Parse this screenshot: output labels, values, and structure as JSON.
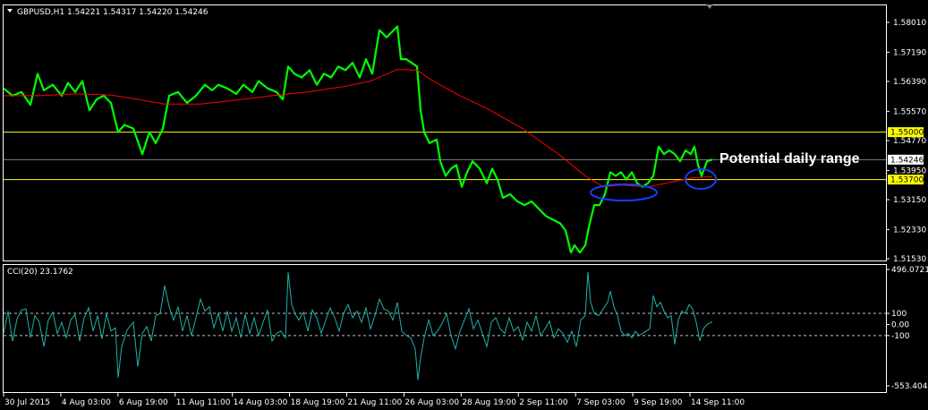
{
  "main_title": "GBPUSD,H1  1.54221 1.54317 1.54220 1.54246",
  "cci_title": "CCI(20) 23.1762",
  "annotation": "Potential daily range",
  "colors": {
    "background": "#000000",
    "price": "#00ff00",
    "ma": "#ff0000",
    "cci": "#20b2aa",
    "levels": "#ffff00",
    "current_line": "#808080",
    "ellipse": "#0000ff",
    "frame": "#ffffff"
  },
  "chart_data": [
    {
      "type": "line",
      "panel": "price",
      "symbol": "GBPUSD",
      "timeframe": "H1",
      "ohlc": {
        "open": 1.54221,
        "high": 1.54317,
        "low": 1.5422,
        "close": 1.54246
      },
      "ylim": [
        1.5153,
        1.5833
      ],
      "y_ticks": [
        "1.58010",
        "1.57190",
        "1.56390",
        "1.55570",
        "1.54770",
        "1.53950",
        "1.53150",
        "1.52330",
        "1.51530"
      ],
      "x_ticks": [
        "30 Jul 2015",
        "4 Aug 03:00",
        "6 Aug 19:00",
        "11 Aug 11:00",
        "14 Aug 03:00",
        "18 Aug 19:00",
        "21 Aug 11:00",
        "26 Aug 03:00",
        "28 Aug 19:00",
        "2 Sep 11:00",
        "7 Sep 03:00",
        "9 Sep 19:00",
        "14 Sep 11:00"
      ],
      "levels": [
        {
          "value": 1.55,
          "label": "1.55000",
          "color": "#ffff00"
        },
        {
          "value": 1.537,
          "label": "1.53700",
          "color": "#ffff00"
        }
      ],
      "current_price": {
        "value": 1.54246,
        "label": "1.54246"
      },
      "series": [
        {
          "color": "#00ff00",
          "values": [
            [
              0,
              1.562
            ],
            [
              10,
              1.56
            ],
            [
              20,
              1.561
            ],
            [
              30,
              1.5575
            ],
            [
              38,
              1.566
            ],
            [
              45,
              1.5615
            ],
            [
              55,
              1.563
            ],
            [
              65,
              1.56
            ],
            [
              72,
              1.5635
            ],
            [
              80,
              1.561
            ],
            [
              88,
              1.564
            ],
            [
              96,
              1.556
            ],
            [
              104,
              1.559
            ],
            [
              112,
              1.56
            ],
            [
              120,
              1.558
            ],
            [
              128,
              1.55
            ],
            [
              135,
              1.552
            ],
            [
              145,
              1.551
            ],
            [
              155,
              1.544
            ],
            [
              163,
              1.55
            ],
            [
              170,
              1.547
            ],
            [
              178,
              1.551
            ],
            [
              185,
              1.56
            ],
            [
              195,
              1.561
            ],
            [
              205,
              1.558
            ],
            [
              215,
              1.56
            ],
            [
              225,
              1.563
            ],
            [
              233,
              1.5615
            ],
            [
              240,
              1.563
            ],
            [
              250,
              1.562
            ],
            [
              260,
              1.5605
            ],
            [
              268,
              1.563
            ],
            [
              278,
              1.561
            ],
            [
              285,
              1.564
            ],
            [
              295,
              1.562
            ],
            [
              305,
              1.561
            ],
            [
              312,
              1.559
            ],
            [
              318,
              1.568
            ],
            [
              325,
              1.566
            ],
            [
              333,
              1.565
            ],
            [
              342,
              1.567
            ],
            [
              350,
              1.563
            ],
            [
              358,
              1.566
            ],
            [
              366,
              1.565
            ],
            [
              374,
              1.568
            ],
            [
              382,
              1.567
            ],
            [
              390,
              1.569
            ],
            [
              398,
              1.565
            ],
            [
              405,
              1.57
            ],
            [
              412,
              1.566
            ],
            [
              420,
              1.578
            ],
            [
              428,
              1.576
            ],
            [
              436,
              1.578
            ],
            [
              440,
              1.579
            ],
            [
              444,
              1.57
            ],
            [
              450,
              1.57
            ],
            [
              456,
              1.569
            ],
            [
              462,
              1.568
            ],
            [
              466,
              1.556
            ],
            [
              470,
              1.55
            ],
            [
              476,
              1.547
            ],
            [
              484,
              1.548
            ],
            [
              488,
              1.542
            ],
            [
              494,
              1.538
            ],
            [
              500,
              1.54
            ],
            [
              506,
              1.541
            ],
            [
              512,
              1.535
            ],
            [
              518,
              1.539
            ],
            [
              524,
              1.542
            ],
            [
              532,
              1.54
            ],
            [
              540,
              1.536
            ],
            [
              546,
              1.54
            ],
            [
              552,
              1.537
            ],
            [
              558,
              1.532
            ],
            [
              566,
              1.533
            ],
            [
              574,
              1.531
            ],
            [
              582,
              1.53
            ],
            [
              590,
              1.531
            ],
            [
              598,
              1.529
            ],
            [
              606,
              1.527
            ],
            [
              614,
              1.526
            ],
            [
              622,
              1.525
            ],
            [
              628,
              1.523
            ],
            [
              634,
              1.517
            ],
            [
              638,
              1.519
            ],
            [
              644,
              1.517
            ],
            [
              650,
              1.519
            ],
            [
              654,
              1.524
            ],
            [
              660,
              1.53
            ],
            [
              666,
              1.53
            ],
            [
              672,
              1.533
            ],
            [
              678,
              1.539
            ],
            [
              684,
              1.538
            ],
            [
              690,
              1.539
            ],
            [
              696,
              1.537
            ],
            [
              702,
              1.539
            ],
            [
              708,
              1.536
            ],
            [
              714,
              1.535
            ],
            [
              720,
              1.536
            ],
            [
              726,
              1.538
            ],
            [
              732,
              1.546
            ],
            [
              738,
              1.544
            ],
            [
              744,
              1.545
            ],
            [
              750,
              1.544
            ],
            [
              756,
              1.542
            ],
            [
              762,
              1.545
            ],
            [
              768,
              1.544
            ],
            [
              772,
              1.546
            ],
            [
              776,
              1.541
            ],
            [
              780,
              1.538
            ],
            [
              786,
              1.542
            ],
            [
              792,
              1.5425
            ]
          ]
        },
        {
          "color": "#ff0000",
          "values": [
            [
              0,
              1.56
            ],
            [
              40,
              1.56
            ],
            [
              80,
              1.5605
            ],
            [
              120,
              1.5602
            ],
            [
              150,
              1.559
            ],
            [
              180,
              1.5577
            ],
            [
              220,
              1.5577
            ],
            [
              260,
              1.5588
            ],
            [
              300,
              1.56
            ],
            [
              340,
              1.561
            ],
            [
              380,
              1.5625
            ],
            [
              410,
              1.564
            ],
            [
              440,
              1.5672
            ],
            [
              462,
              1.567
            ],
            [
              480,
              1.564
            ],
            [
              510,
              1.56
            ],
            [
              540,
              1.5565
            ],
            [
              580,
              1.551
            ],
            [
              620,
              1.544
            ],
            [
              650,
              1.538
            ],
            [
              670,
              1.535
            ],
            [
              690,
              1.5355
            ],
            [
              720,
              1.535
            ],
            [
              750,
              1.5365
            ],
            [
              770,
              1.5375
            ],
            [
              792,
              1.5378
            ]
          ]
        }
      ]
    },
    {
      "type": "line",
      "panel": "indicator",
      "name": "CCI(20)",
      "current": 23.1762,
      "ylim": [
        -553.4042,
        496.0721
      ],
      "y_ticks": [
        "496.0721",
        "100",
        "0.00",
        "-100",
        "-553.4042"
      ],
      "levels": [
        100,
        -100
      ],
      "values": [
        [
          0,
          -80
        ],
        [
          5,
          120
        ],
        [
          10,
          -150
        ],
        [
          15,
          50
        ],
        [
          20,
          130
        ],
        [
          25,
          140
        ],
        [
          30,
          -120
        ],
        [
          35,
          80
        ],
        [
          40,
          20
        ],
        [
          45,
          -200
        ],
        [
          50,
          40
        ],
        [
          55,
          110
        ],
        [
          60,
          -80
        ],
        [
          65,
          20
        ],
        [
          70,
          -120
        ],
        [
          75,
          40
        ],
        [
          80,
          90
        ],
        [
          85,
          -150
        ],
        [
          90,
          60
        ],
        [
          95,
          150
        ],
        [
          100,
          -60
        ],
        [
          105,
          80
        ],
        [
          110,
          -130
        ],
        [
          115,
          100
        ],
        [
          120,
          -60
        ],
        [
          125,
          -30
        ],
        [
          128,
          -480
        ],
        [
          132,
          -200
        ],
        [
          138,
          -50
        ],
        [
          145,
          20
        ],
        [
          150,
          -380
        ],
        [
          155,
          -80
        ],
        [
          160,
          -20
        ],
        [
          165,
          -150
        ],
        [
          170,
          80
        ],
        [
          175,
          100
        ],
        [
          180,
          350
        ],
        [
          185,
          160
        ],
        [
          190,
          40
        ],
        [
          195,
          160
        ],
        [
          200,
          -60
        ],
        [
          205,
          80
        ],
        [
          210,
          -100
        ],
        [
          215,
          60
        ],
        [
          220,
          230
        ],
        [
          225,
          120
        ],
        [
          230,
          160
        ],
        [
          235,
          -30
        ],
        [
          240,
          100
        ],
        [
          245,
          -60
        ],
        [
          250,
          120
        ],
        [
          255,
          -60
        ],
        [
          260,
          60
        ],
        [
          265,
          -120
        ],
        [
          270,
          90
        ],
        [
          275,
          -80
        ],
        [
          280,
          60
        ],
        [
          285,
          -100
        ],
        [
          290,
          20
        ],
        [
          295,
          130
        ],
        [
          300,
          -150
        ],
        [
          305,
          -80
        ],
        [
          310,
          -60
        ],
        [
          315,
          -120
        ],
        [
          318,
          470
        ],
        [
          322,
          180
        ],
        [
          326,
          90
        ],
        [
          330,
          40
        ],
        [
          335,
          110
        ],
        [
          340,
          -60
        ],
        [
          345,
          130
        ],
        [
          350,
          60
        ],
        [
          355,
          -80
        ],
        [
          360,
          40
        ],
        [
          365,
          150
        ],
        [
          370,
          60
        ],
        [
          375,
          -60
        ],
        [
          380,
          100
        ],
        [
          385,
          180
        ],
        [
          390,
          60
        ],
        [
          395,
          120
        ],
        [
          400,
          20
        ],
        [
          405,
          150
        ],
        [
          410,
          -40
        ],
        [
          415,
          80
        ],
        [
          420,
          230
        ],
        [
          425,
          140
        ],
        [
          430,
          120
        ],
        [
          435,
          40
        ],
        [
          440,
          200
        ],
        [
          445,
          -60
        ],
        [
          450,
          -100
        ],
        [
          455,
          -120
        ],
        [
          460,
          -220
        ],
        [
          463,
          -500
        ],
        [
          466,
          -300
        ],
        [
          470,
          -120
        ],
        [
          475,
          40
        ],
        [
          480,
          -100
        ],
        [
          485,
          -60
        ],
        [
          490,
          10
        ],
        [
          495,
          100
        ],
        [
          500,
          -100
        ],
        [
          505,
          -220
        ],
        [
          510,
          -60
        ],
        [
          515,
          40
        ],
        [
          520,
          140
        ],
        [
          525,
          -40
        ],
        [
          530,
          40
        ],
        [
          535,
          -80
        ],
        [
          540,
          -200
        ],
        [
          545,
          20
        ],
        [
          550,
          60
        ],
        [
          555,
          -40
        ],
        [
          560,
          -80
        ],
        [
          565,
          60
        ],
        [
          570,
          -60
        ],
        [
          575,
          -20
        ],
        [
          580,
          -140
        ],
        [
          585,
          20
        ],
        [
          590,
          -60
        ],
        [
          595,
          80
        ],
        [
          600,
          -100
        ],
        [
          605,
          -40
        ],
        [
          610,
          30
        ],
        [
          615,
          -120
        ],
        [
          620,
          -40
        ],
        [
          625,
          -80
        ],
        [
          630,
          -160
        ],
        [
          635,
          -60
        ],
        [
          640,
          -200
        ],
        [
          645,
          40
        ],
        [
          650,
          80
        ],
        [
          653,
          470
        ],
        [
          656,
          200
        ],
        [
          660,
          100
        ],
        [
          665,
          80
        ],
        [
          670,
          140
        ],
        [
          675,
          200
        ],
        [
          678,
          300
        ],
        [
          682,
          160
        ],
        [
          686,
          80
        ],
        [
          690,
          -60
        ],
        [
          694,
          -100
        ],
        [
          698,
          -80
        ],
        [
          702,
          -120
        ],
        [
          706,
          -60
        ],
        [
          710,
          -100
        ],
        [
          714,
          -80
        ],
        [
          718,
          -60
        ],
        [
          722,
          -40
        ],
        [
          726,
          260
        ],
        [
          730,
          160
        ],
        [
          734,
          200
        ],
        [
          738,
          120
        ],
        [
          742,
          60
        ],
        [
          746,
          80
        ],
        [
          750,
          -180
        ],
        [
          754,
          40
        ],
        [
          758,
          120
        ],
        [
          762,
          100
        ],
        [
          766,
          180
        ],
        [
          770,
          140
        ],
        [
          774,
          20
        ],
        [
          778,
          -150
        ],
        [
          782,
          -40
        ],
        [
          786,
          0
        ],
        [
          792,
          23
        ]
      ]
    }
  ]
}
